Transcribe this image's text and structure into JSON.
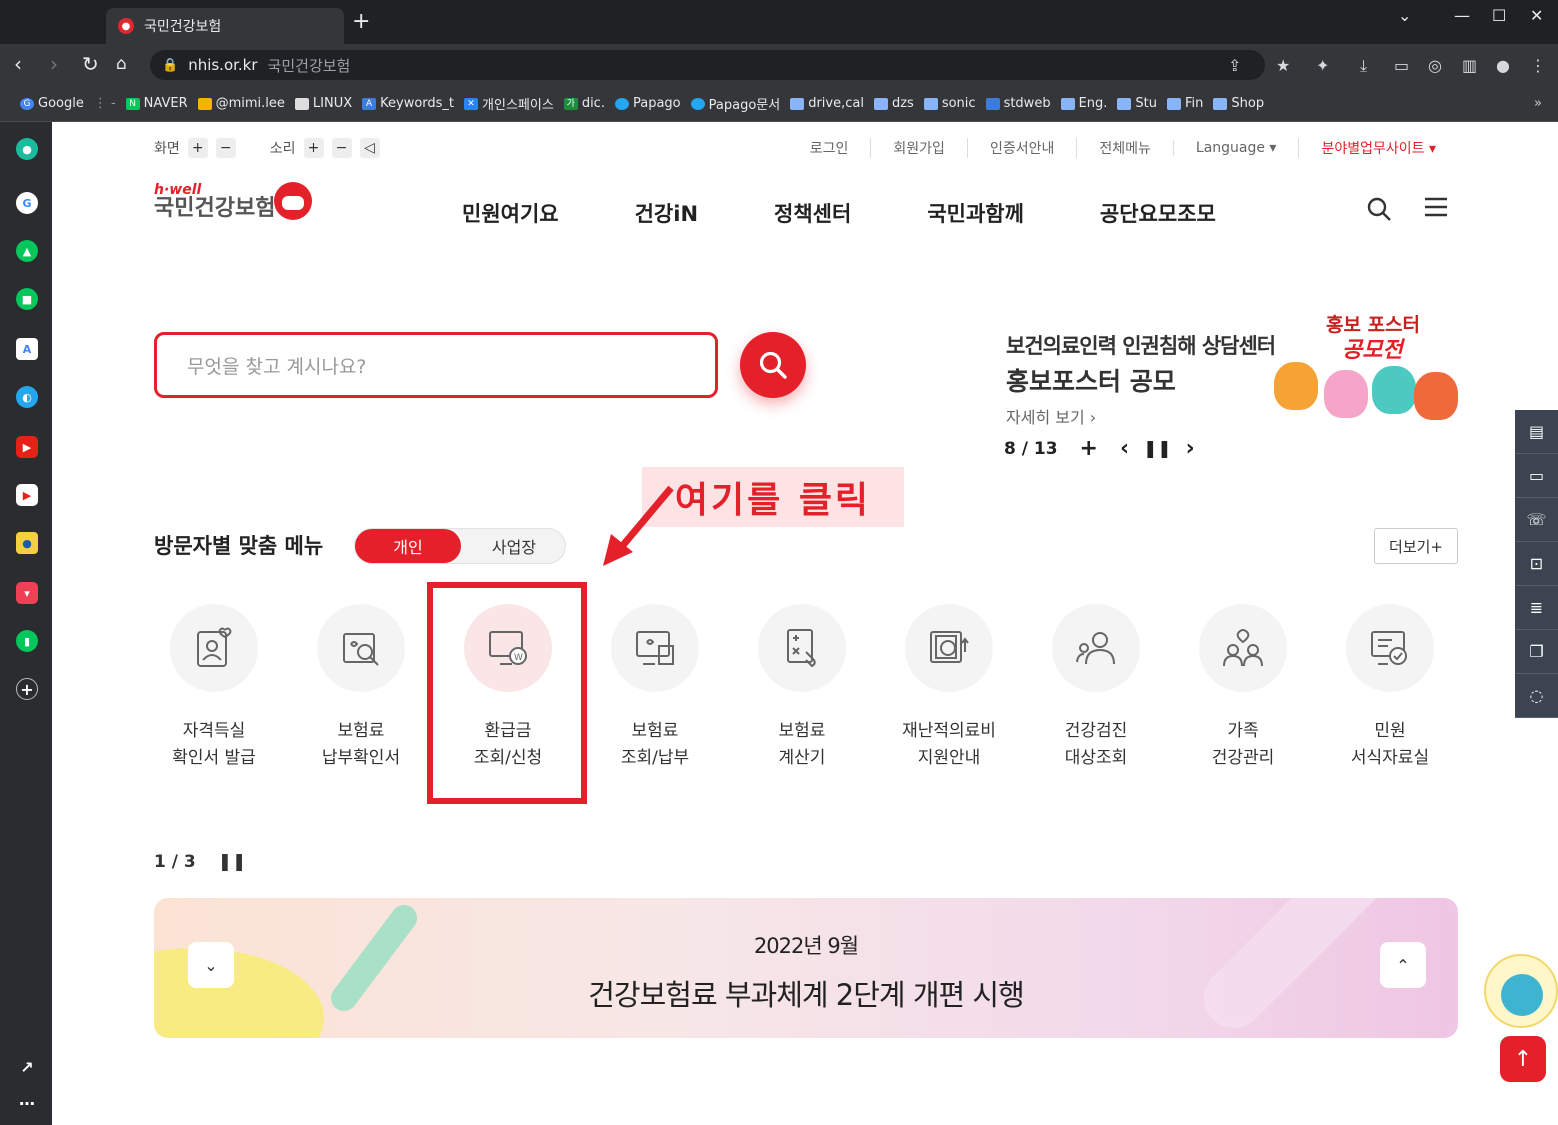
{
  "browser": {
    "tab_title": "국민건강보험",
    "url": "nhis.or.kr",
    "page_title": "국민건강보험",
    "bookmarks": [
      "Google",
      "NAVER",
      "@mimi.lee",
      "LINUX",
      "Keywords_t",
      "개인스페이스",
      "dic.",
      "Papago",
      "Papago문서",
      "drive,cal",
      "dzs",
      "sonic",
      "stdweb",
      "Eng.",
      "Stu",
      "Fin",
      "Shop"
    ]
  },
  "util": {
    "screen_label": "화면",
    "sound_label": "소리",
    "links": [
      "로그인",
      "회원가입",
      "인증서안내",
      "전체메뉴",
      "Language ▾",
      "분야별업무사이트 ▾"
    ]
  },
  "logo": {
    "hwell": "h·well",
    "name": "국민건강보험"
  },
  "gnb": [
    "민원여기요",
    "건강iN",
    "정책센터",
    "국민과함께",
    "공단요모조모"
  ],
  "search": {
    "placeholder": "무엇을 찾고 계시나요?"
  },
  "banner": {
    "title": "보건의료인력 인권침해 상담센터",
    "subtitle": "홍보포스터 공모",
    "more": "자세히 보기 ›",
    "counter": "8 / 13",
    "poster_line1": "홍보 포스터",
    "poster_line2": "공모전"
  },
  "annotation": {
    "text": "여기를 클릭"
  },
  "visitor": {
    "title": "방문자별 맞춤 메뉴",
    "toggle_on": "개인",
    "toggle_off": "사업장",
    "more": "더보기+",
    "items": [
      {
        "label": "자격득실\n확인서 발급",
        "icon": "id-card-icon"
      },
      {
        "label": "보험료\n납부확인서",
        "icon": "doc-search-icon"
      },
      {
        "label": "환급금\n조회/신청",
        "icon": "monitor-refund-icon"
      },
      {
        "label": "보험료\n조회/납부",
        "icon": "payment-icon"
      },
      {
        "label": "보험료\n계산기",
        "icon": "calculator-icon"
      },
      {
        "label": "재난적의료비\n지원안내",
        "icon": "medical-support-icon"
      },
      {
        "label": "건강검진\n대상조회",
        "icon": "checkup-icon"
      },
      {
        "label": "가족\n건강관리",
        "icon": "family-icon"
      },
      {
        "label": "민원\n서식자료실",
        "icon": "forms-icon"
      }
    ],
    "pager": "1 / 3"
  },
  "notice": {
    "date": "2022년 9월",
    "title": "건강보험료 부과체계 2단계 개편 시행"
  },
  "colors": {
    "brand_red": "#e4202b",
    "quick_bg": "#3d4451"
  }
}
